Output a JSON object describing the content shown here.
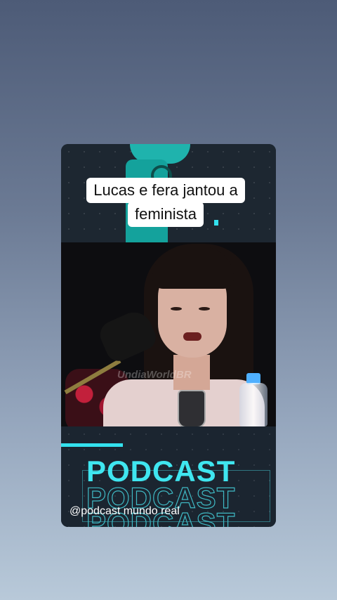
{
  "title": {
    "line1": "Lucas e fera jantou a",
    "line2": "feminista"
  },
  "video": {
    "watermark": "UndiaWorldBR"
  },
  "branding": {
    "podcast_text": "PODCAST",
    "handle": "@podcast mundo real"
  },
  "colors": {
    "accent": "#33e1ee",
    "card_bg": "#1b2530"
  }
}
